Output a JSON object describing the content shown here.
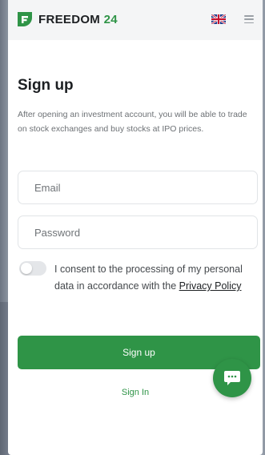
{
  "header": {
    "brand_name": "FREEDOM",
    "brand_number": "24",
    "language_icon": "uk-flag-icon",
    "menu_icon": "hamburger-menu-icon"
  },
  "signup": {
    "title": "Sign up",
    "description": "After opening an investment account, you will be able to trade on stock exchanges and buy stocks at IPO prices.",
    "email_placeholder": "Email",
    "email_value": "",
    "password_placeholder": "Password",
    "password_value": "",
    "consent_text": "I consent to the processing of my personal data in accordance with the",
    "privacy_link": "Privacy Policy",
    "consent_checked": false,
    "submit_label": "Sign up",
    "signin_label": "Sign In"
  },
  "chat": {
    "icon": "chat-icon"
  },
  "colors": {
    "brand_green": "#2f9447",
    "text_dark": "#1c1f22",
    "text_muted": "#6d7175",
    "field_border": "#e1e4e7",
    "header_bg": "#f4f5f6"
  }
}
